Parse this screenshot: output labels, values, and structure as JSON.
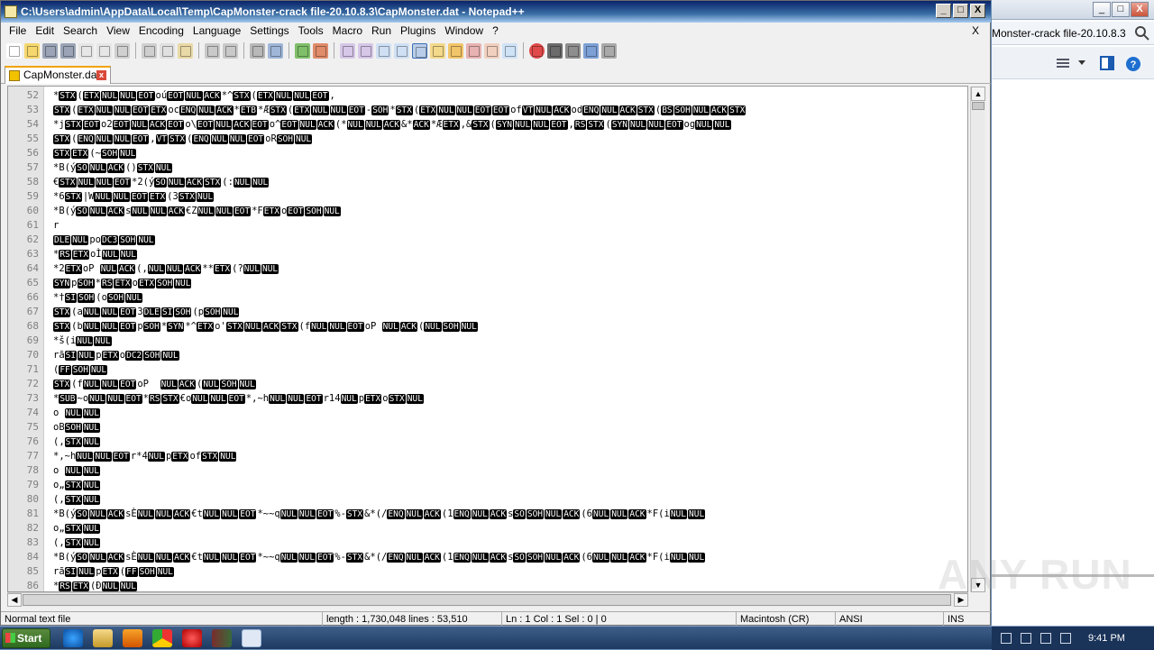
{
  "background_window": {
    "address_text": "Monster-crack file-20.10.8.3",
    "caption_buttons": [
      "_",
      "□",
      "X"
    ]
  },
  "window": {
    "title": "C:\\Users\\admin\\AppData\\Local\\Temp\\CapMonster-crack file-20.10.8.3\\CapMonster.dat - Notepad++",
    "caption_buttons": [
      "_",
      "□",
      "X"
    ]
  },
  "menu": {
    "items": [
      "File",
      "Edit",
      "Search",
      "View",
      "Encoding",
      "Language",
      "Settings",
      "Tools",
      "Macro",
      "Run",
      "Plugins",
      "Window",
      "?"
    ],
    "close_label": "X"
  },
  "tab": {
    "label": "CapMonster.dat",
    "close": "x"
  },
  "editor": {
    "line_numbers": [
      "52",
      "53",
      "54",
      "55",
      "56",
      "57",
      "58",
      "59",
      "60",
      "61",
      "62",
      "63",
      "64",
      "65",
      "66",
      "67",
      "68",
      "69",
      "70",
      "71",
      "72",
      "73",
      "74",
      "75",
      "76",
      "77",
      "78",
      "79",
      "80",
      "81",
      "82",
      "83",
      "84",
      "85",
      "86"
    ],
    "lines": [
      "*[STX]([ETX][NUL][NUL][EOT]oú[EOT][NUL][ACK]*^[STX]([ETX][NUL][NUL][EOT],",
      "[STX]([ETX][NUL][NUL][EOT][ETX]oc[ENQ][NUL][ACK]*[ETB]*Æ[STX]([ETX][NUL][NUL][EOT]-[SOH]*[STX]([ETX][NUL][NUL][EOT][EOT]of[VT][NUL][ACK]od[ENQ][NUL][ACK][STX]([BS][SOH][NUL][ACK][STX]",
      "*j[STX][EOT]o2[EOT][NUL][ACK][EOT]o\\[EOT][NUL][ACK][EOT]o^[EOT][NUL][ACK](*[NUL][NUL][ACK]&*[ACK]*Æ[ETX],&[STX]([SYN][NUL][NUL][EOT],[RS][STX]([SYN][NUL][NUL][EOT]og[NUL][NUL]",
      "[STX]([ENQ][NUL][NUL][EOT],[VT][STX]([ENQ][NUL][NUL][EOT]oR[SOH][NUL]",
      "[STX][ETX](~[SOH][NUL]",
      "*B(ý[SO][NUL][ACK]()[STX][NUL]",
      "€[STX][NUL][NUL][EOT]*2(ý[SO][NUL][ACK][STX](:[NUL][NUL]",
      "*6[STX]|W[NUL][NUL][EOT][ETX](3[STX][NUL]",
      "*B(ý[SO][NUL][ACK]s[NUL][NUL][ACK]€Z[NUL][NUL][EOT]*F[ETX]o[EOT][SOH][NUL]",
      "r",
      "[DLE][NUL]po[DC3][SOH][NUL]",
      "*[RS][ETX]oÌ[NUL][NUL]",
      "*2[ETX]oP [NUL][ACK](,[NUL][NUL][ACK]**[ETX](?[NUL][NUL]",
      "[SYN]p[SOH]*[RS][ETX]o[ETX][SOH][NUL]",
      "*†[SI][SOH](o[SOH][NUL]",
      "[STX](a[NUL][NUL][EOT]3[DLE][SI][SOH](p[SOH][NUL]",
      "[STX](b[NUL][NUL][EOT]p[SOH]*[SYN]*^[ETX]o'[STX][NUL][ACK][STX](f[NUL][NUL][EOT]oP [NUL][ACK]([NUL][SOH][NUL]",
      "*š(i[NUL][NUL]",
      "rã[SI][NUL]p[ETX]o[DC2][SOH][NUL]",
      "([FF][SOH][NUL]",
      "[STX](f[NUL][NUL][EOT]oP  [NUL][ACK]([NUL][SOH][NUL]",
      "*[SUB]~o[NUL][NUL][EOT]*[RS][STX]€o[NUL][NUL][EOT]*,~h[NUL][NUL][EOT]r14[NUL]p[ETX]o[STX][NUL]",
      "o [NUL][NUL]",
      "oB[SOH][NUL]",
      "(,[STX][NUL]",
      "*,~h[NUL][NUL][EOT]r*4[NUL]p[ETX]of[STX][NUL]",
      "o [NUL][NUL]",
      "o„[STX][NUL]",
      "(,[STX][NUL]",
      "*B(ý[SO][NUL][ACK]sÈ[NUL][NUL][ACK]€t[NUL][NUL][EOT]*~~q[NUL][NUL][EOT]%-[STX]&*(/[ENQ][NUL][ACK](1[ENQ][NUL][ACK]s[SO][SOH][NUL][ACK](6[NUL][NUL][ACK]*F(i[NUL][NUL]",
      "o„[STX][NUL]",
      "(,[STX][NUL]",
      "*B(ý[SO][NUL][ACK]sÈ[NUL][NUL][ACK]€t[NUL][NUL][EOT]*~~q[NUL][NUL][EOT]%-[STX]&*(/[ENQ][NUL][ACK](1[ENQ][NUL][ACK]s[SO][SOH][NUL][ACK](6[NUL][NUL][ACK]*F(i[NUL][NUL]",
      "rã[SI][NUL]p[ETX]([FF][SOH][NUL]",
      "*[RS][ETX](Ð[NUL][NUL]"
    ]
  },
  "statusbar": {
    "filetype": "Normal text file",
    "length": "length : 1,730,048    lines : 53,510",
    "position": "Ln : 1    Col : 1    Sel : 0 | 0",
    "eol": "Macintosh (CR)",
    "encoding": "ANSI",
    "mode": "INS"
  },
  "taskbar": {
    "start_label": "Start",
    "clock": "9:41 PM"
  },
  "watermark": "ANY RUN",
  "colors": {
    "title_bar": "#0a246a",
    "control_char_bg": "#000000",
    "control_char_fg": "#ffffff",
    "tab_accent": "#f2a300"
  }
}
